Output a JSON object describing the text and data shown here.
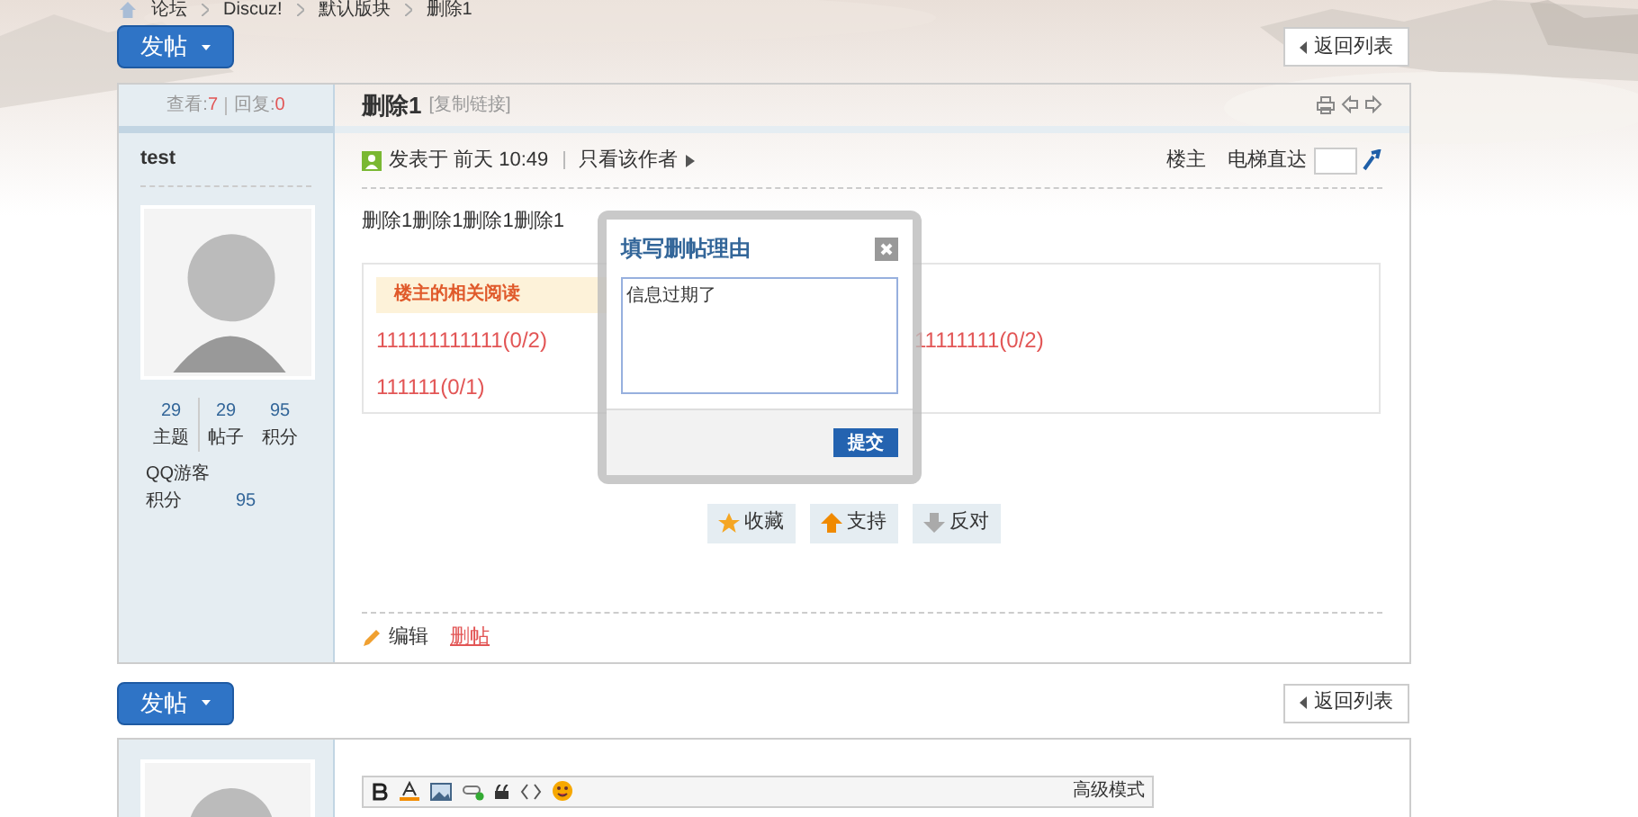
{
  "breadcrumb": [
    "论坛",
    "Discuz!",
    "默认版块",
    "删除1"
  ],
  "post_button": "发帖",
  "back_button": "返回列表",
  "stats": {
    "views_label": "查看:",
    "views": "7",
    "replies_label": "回复:",
    "replies": "0"
  },
  "thread": {
    "title": "删除1",
    "copy_link": "[复制链接]"
  },
  "author": {
    "name": "test",
    "counts": [
      {
        "value": "29",
        "label": "主题"
      },
      {
        "value": "29",
        "label": "帖子"
      },
      {
        "value": "95",
        "label": "积分"
      }
    ],
    "group": "QQ游客",
    "points_label": "积分",
    "points": "95"
  },
  "post": {
    "meta": "发表于 前天 10:49",
    "only_author": "只看该作者",
    "floor": "楼主",
    "jump_label": "电梯直达",
    "body": "删除1删除1删除1删除1",
    "related": {
      "title": "楼主的相关阅读",
      "items": [
        "111111111111(0/2)",
        "11111111(0/2)",
        "111111(0/1)"
      ]
    },
    "actions": [
      {
        "kind": "star",
        "label": "收藏"
      },
      {
        "kind": "up",
        "label": "支持"
      },
      {
        "kind": "down",
        "label": "反对"
      }
    ],
    "edit": "编辑",
    "delete": "删帖"
  },
  "dialog": {
    "title": "填写删帖理由",
    "value": "信息过期了",
    "submit": "提交"
  },
  "editor": {
    "mode": "高级模式"
  },
  "bottom_post_button": "发帖",
  "bottom_back_button": "返回列表"
}
